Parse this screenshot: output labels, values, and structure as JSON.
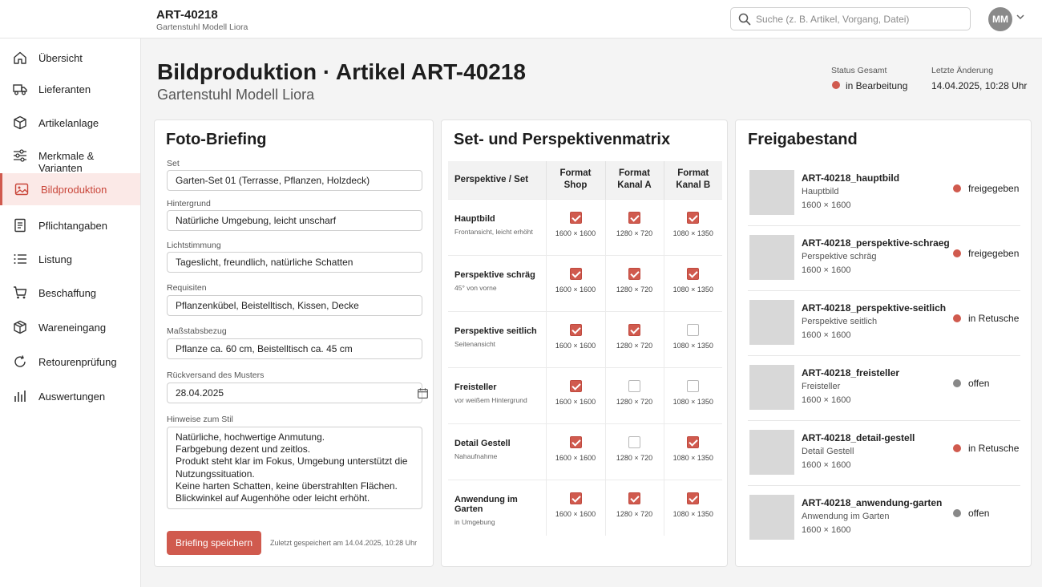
{
  "app": {
    "article_code": "ART-40218",
    "article_name": "Gartenstuhl Modell Liora"
  },
  "search": {
    "placeholder": "Suche (z. B. Artikel, Vorgang, Datei)"
  },
  "user": {
    "initials": "MM"
  },
  "colors": {
    "accent": "#d05a4e",
    "neutral_status": "#888888"
  },
  "sidebar": {
    "items": [
      {
        "label": "Übersicht",
        "icon": "home-icon",
        "active": false
      },
      {
        "label": "Lieferanten",
        "icon": "truck-icon",
        "active": false
      },
      {
        "label": "Artikelanlage",
        "icon": "box-icon",
        "active": false
      },
      {
        "label": "Merkmale & Varianten",
        "icon": "sliders-icon",
        "active": false
      },
      {
        "label": "Bildproduktion",
        "icon": "image-icon",
        "active": true
      },
      {
        "label": "Pflichtangaben",
        "icon": "document-icon",
        "active": false
      },
      {
        "label": "Listung",
        "icon": "list-icon",
        "active": false
      },
      {
        "label": "Beschaffung",
        "icon": "cart-icon",
        "active": false
      },
      {
        "label": "Wareneingang",
        "icon": "package-icon",
        "active": false
      },
      {
        "label": "Retourenprüfung",
        "icon": "refresh-icon",
        "active": false
      },
      {
        "label": "Auswertungen",
        "icon": "bar-chart-icon",
        "active": false
      }
    ]
  },
  "page": {
    "title": "Bildproduktion · Artikel ART-40218",
    "subtitle": "Gartenstuhl Modell Liora",
    "status_label": "Status Gesamt",
    "status_value": "in Bearbeitung",
    "last_change_label": "Letzte Änderung",
    "last_change_value": "14.04.2025, 10:28 Uhr"
  },
  "briefing": {
    "title": "Foto-Briefing",
    "fields": {
      "set": {
        "label": "Set",
        "value": "Garten-Set 01 (Terrasse, Pflanzen, Holzdeck)"
      },
      "hintergrund": {
        "label": "Hintergrund",
        "value": "Natürliche Umgebung, leicht unscharf"
      },
      "licht": {
        "label": "Lichtstimmung",
        "value": "Tageslicht, freundlich, natürliche Schatten"
      },
      "requisiten": {
        "label": "Requisiten",
        "value": "Pflanzenkübel, Beistelltisch, Kissen, Decke"
      },
      "massstab": {
        "label": "Maßstabsbezug",
        "value": "Pflanze ca. 60 cm, Beistelltisch ca. 45 cm"
      },
      "rueckversand": {
        "label": "Rückversand des Musters",
        "value": "28.04.2025"
      },
      "stil": {
        "label": "Hinweise zum Stil",
        "value": "Natürliche, hochwertige Anmutung.\nFarbgebung dezent und zeitlos.\nProdukt steht klar im Fokus, Umgebung unterstützt die Nutzungssituation.\nKeine harten Schatten, keine überstrahlten Flächen.\nBlickwinkel auf Augenhöhe oder leicht erhöht."
      }
    },
    "save_label": "Briefing speichern",
    "saved_note": "Zuletzt gespeichert am 14.04.2025, 10:28 Uhr"
  },
  "matrix": {
    "title": "Set- und Perspektivenmatrix",
    "headers": [
      "Perspektive / Set",
      "Format Shop",
      "Format Kanal A",
      "Format Kanal B"
    ],
    "rows": [
      {
        "title": "Hauptbild",
        "sub": "Frontansicht, leicht erhöht",
        "cells": [
          {
            "checked": true,
            "dim": "1600 × 1600"
          },
          {
            "checked": true,
            "dim": "1280 × 720"
          },
          {
            "checked": true,
            "dim": "1080 × 1350"
          }
        ]
      },
      {
        "title": "Perspektive schräg",
        "sub": "45° von vorne",
        "cells": [
          {
            "checked": true,
            "dim": "1600 × 1600"
          },
          {
            "checked": true,
            "dim": "1280 × 720"
          },
          {
            "checked": true,
            "dim": "1080 × 1350"
          }
        ]
      },
      {
        "title": "Perspektive seitlich",
        "sub": "Seitenansicht",
        "cells": [
          {
            "checked": true,
            "dim": "1600 × 1600"
          },
          {
            "checked": true,
            "dim": "1280 × 720"
          },
          {
            "checked": false,
            "dim": "1080 × 1350"
          }
        ]
      },
      {
        "title": "Freisteller",
        "sub": "vor weißem Hintergrund",
        "cells": [
          {
            "checked": true,
            "dim": "1600 × 1600"
          },
          {
            "checked": false,
            "dim": "1280 × 720"
          },
          {
            "checked": false,
            "dim": "1080 × 1350"
          }
        ]
      },
      {
        "title": "Detail Gestell",
        "sub": "Nahaufnahme",
        "cells": [
          {
            "checked": true,
            "dim": "1600 × 1600"
          },
          {
            "checked": false,
            "dim": "1280 × 720"
          },
          {
            "checked": true,
            "dim": "1080 × 1350"
          }
        ]
      },
      {
        "title": "Anwendung im Garten",
        "sub": "in Umgebung",
        "cells": [
          {
            "checked": true,
            "dim": "1600 × 1600"
          },
          {
            "checked": true,
            "dim": "1280 × 720"
          },
          {
            "checked": true,
            "dim": "1080 × 1350"
          }
        ]
      }
    ]
  },
  "release": {
    "title": "Freigabestand",
    "items": [
      {
        "name": "ART-40218_hauptbild",
        "desc": "Hauptbild",
        "dim": "1600 × 1600",
        "status": "freigegeben",
        "status_color": "#d05a4e"
      },
      {
        "name": "ART-40218_perspektive-schraeg",
        "desc": "Perspektive schräg",
        "dim": "1600 × 1600",
        "status": "freigegeben",
        "status_color": "#d05a4e"
      },
      {
        "name": "ART-40218_perspektive-seitlich",
        "desc": "Perspektive seitlich",
        "dim": "1600 × 1600",
        "status": "in Retusche",
        "status_color": "#d05a4e"
      },
      {
        "name": "ART-40218_freisteller",
        "desc": "Freisteller",
        "dim": "1600 × 1600",
        "status": "offen",
        "status_color": "#888888"
      },
      {
        "name": "ART-40218_detail-gestell",
        "desc": "Detail Gestell",
        "dim": "1600 × 1600",
        "status": "in Retusche",
        "status_color": "#d05a4e"
      },
      {
        "name": "ART-40218_anwendung-garten",
        "desc": "Anwendung im Garten",
        "dim": "1600 × 1600",
        "status": "offen",
        "status_color": "#888888"
      }
    ]
  }
}
